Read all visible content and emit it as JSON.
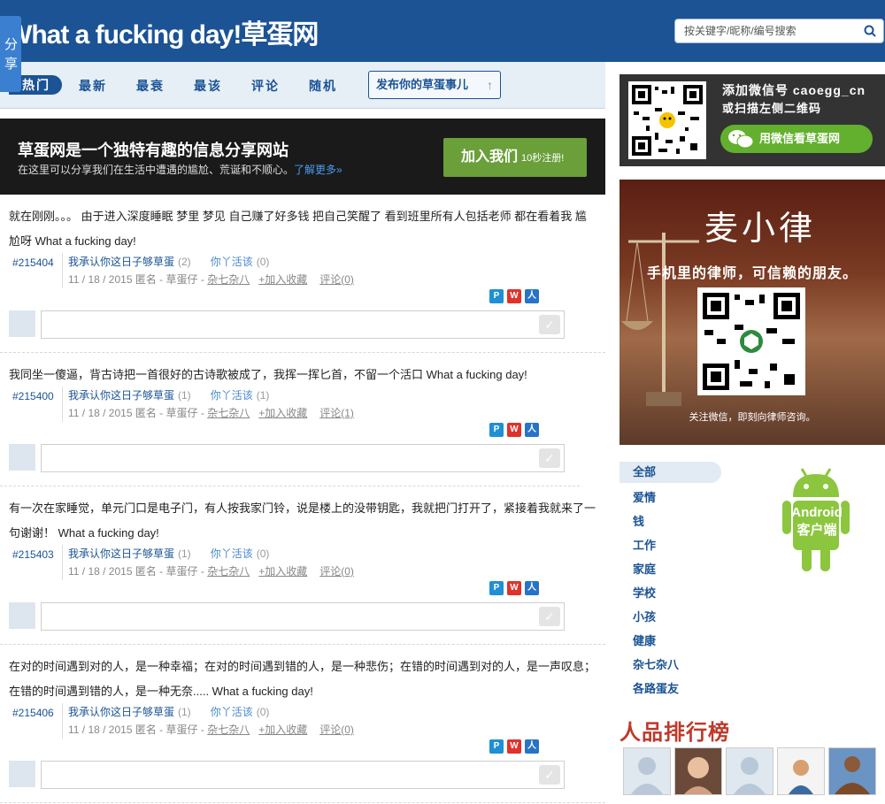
{
  "header": {
    "logo": "What a fucking day!草蛋网",
    "search_placeholder": "按关键字/昵称/编号搜索"
  },
  "share_tab": "分享",
  "nav": {
    "items": [
      "热门",
      "最新",
      "最衰",
      "最该",
      "评论",
      "随机"
    ],
    "publish": "发布你的草蛋事儿"
  },
  "banner": {
    "title": "草蛋网是一个独特有趣的信息分享网站",
    "sub": "在这里可以分享我们在生活中遭遇的尴尬、荒诞和不顺心。",
    "more": "了解更多»",
    "join": "加入我们",
    "join_small": "10秒注册!"
  },
  "posts": [
    {
      "text": "就在刚刚。。。 由于进入深度睡眠 梦里 梦见 自己赚了好多钱 把自己笑醒了 看到班里所有人包括老师 都在看着我 尴尬呀 What a fucking day!",
      "id": "#215404",
      "agree": "我承认你这日子够草蛋",
      "agree_count": "(2)",
      "deserve": "你丫活该",
      "deserve_count": "(0)",
      "date": "11 / 18 / 2015 匿名 - 草蛋仔 -",
      "category": "杂七杂八",
      "fav": "+加入收藏",
      "comment": "评论(0)"
    },
    {
      "text": "我同坐一傻逼，背古诗把一首很好的古诗歌被成了，我挥一挥匕首，不留一个活口 What a fucking day!",
      "id": "#215400",
      "agree": "我承认你这日子够草蛋",
      "agree_count": "(1)",
      "deserve": "你丫活该",
      "deserve_count": "(1)",
      "date": "11 / 18 / 2015 匿名 - 草蛋仔 -",
      "category": "杂七杂八",
      "fav": "+加入收藏",
      "comment": "评论(1)"
    },
    {
      "text": "有一次在家睡觉，单元门口是电子门，有人按我家门铃，说是楼上的没带钥匙，我就把门打开了，紧接着我就来了一句谢谢！ What a fucking day!",
      "id": "#215403",
      "agree": "我承认你这日子够草蛋",
      "agree_count": "(1)",
      "deserve": "你丫活该",
      "deserve_count": "(0)",
      "date": "11 / 18 / 2015 匿名 - 草蛋仔 -",
      "category": "杂七杂八",
      "fav": "+加入收藏",
      "comment": "评论(0)"
    },
    {
      "text": "在对的时间遇到对的人，是一种幸福；在对的时间遇到错的人，是一种悲伤；在错的时间遇到对的人，是一声叹息；在错的时间遇到错的人，是一种无奈..... What a fucking day!",
      "id": "#215406",
      "agree": "我承认你这日子够草蛋",
      "agree_count": "(1)",
      "deserve": "你丫活该",
      "deserve_count": "(0)",
      "date": "11 / 18 / 2015 匿名 - 草蛋仔 -",
      "category": "杂七杂八",
      "fav": "+加入收藏",
      "comment": "评论(0)"
    }
  ],
  "wechat": {
    "line1": "添加微信号 caoegg_cn",
    "line2": "或扫描左侧二维码",
    "button": "用微信看草蛋网"
  },
  "lawyer_ad": {
    "name": "麦小律",
    "tagline": "手机里的律师，可信赖的朋友。",
    "footer": "关注微信，即刻向律师咨询。"
  },
  "categories": [
    "全部",
    "爱情",
    "钱",
    "工作",
    "家庭",
    "学校",
    "小孩",
    "健康",
    "杂七杂八",
    "各路蛋友"
  ],
  "android": {
    "line1": "Android",
    "line2": "客户端"
  },
  "rank_title": "人品排行榜",
  "colors": {
    "header": "#1b5394",
    "accent": "#6a9f3a",
    "rank": "#c0392b"
  }
}
